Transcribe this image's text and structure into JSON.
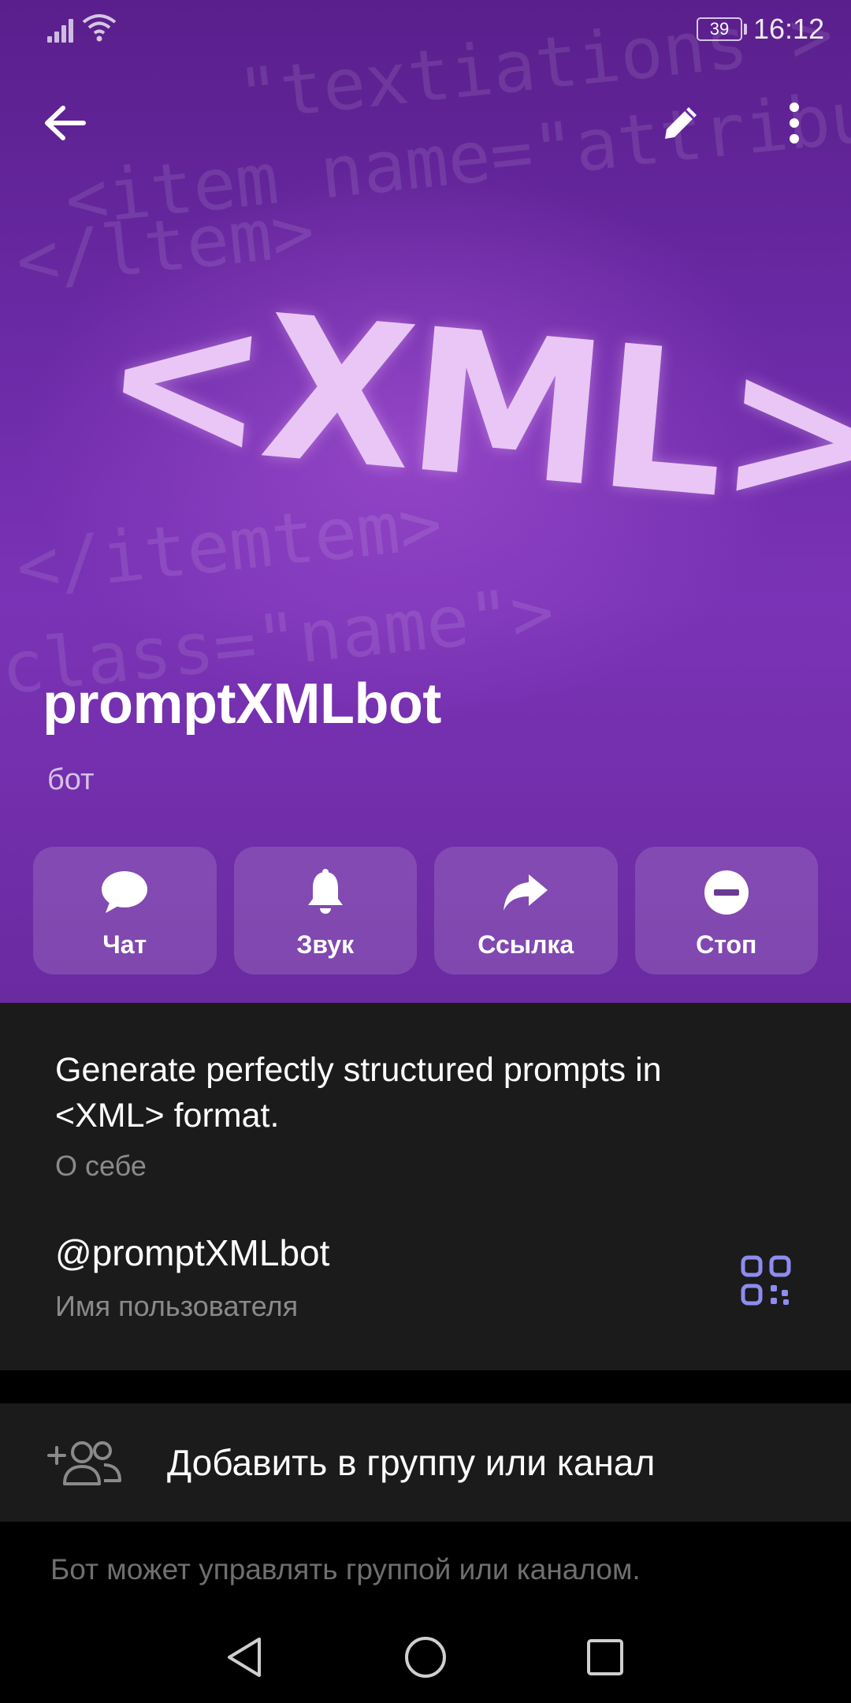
{
  "status": {
    "battery": "39",
    "time": "16:12"
  },
  "hero": {
    "image_text": "<XML>",
    "code_lines": [
      "\"textiations >",
      "<item name=\"attribute\"",
      "</ltem>",
      "</itemtem>",
      "class=\"name\">"
    ]
  },
  "profile": {
    "name": "promptXMLbot",
    "type": "бот"
  },
  "actions": [
    {
      "label": "Чат",
      "icon": "chat-bubble-icon"
    },
    {
      "label": "Звук",
      "icon": "bell-icon"
    },
    {
      "label": "Ссылка",
      "icon": "share-arrow-icon"
    },
    {
      "label": "Стоп",
      "icon": "stop-icon"
    }
  ],
  "about": {
    "text": "Generate perfectly structured prompts in <XML> format.",
    "label": "О себе"
  },
  "username": {
    "value": "@promptXMLbot",
    "label": "Имя пользователя"
  },
  "add_group": {
    "label": "Добавить в группу или канал"
  },
  "hint": "Бот может управлять группой или каналом.",
  "colors": {
    "accent": "#8e8cf0",
    "panel": "#1b1b1b",
    "hero_purple": "#6b2aa6"
  }
}
